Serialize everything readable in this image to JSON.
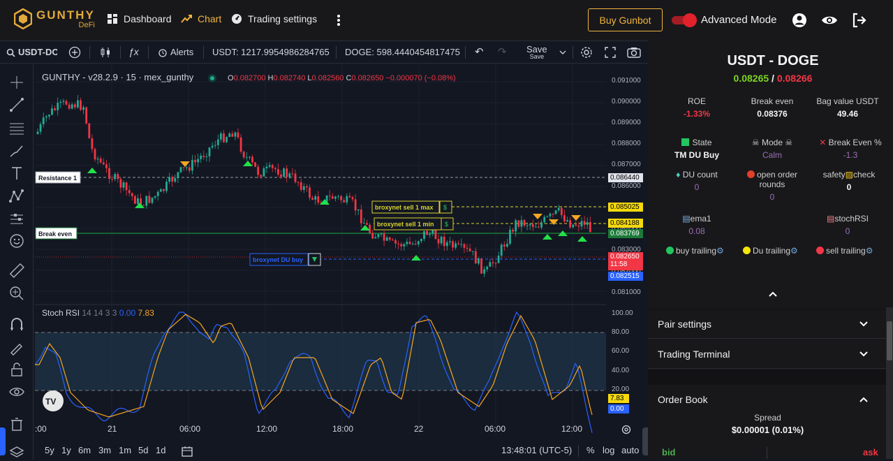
{
  "brand": {
    "name": "GUNTHY",
    "sub": "DeFi"
  },
  "nav": {
    "dashboard": "Dashboard",
    "chart": "Chart",
    "trading_settings": "Trading settings",
    "buy_button": "Buy Gunbot",
    "advanced_mode": "Advanced Mode"
  },
  "toolbar": {
    "symbol": "USDT-DOG",
    "alerts": "Alerts",
    "usdt_balance": "USDT: 1217.9954986284765",
    "doge_balance": "DOGE: 598.4440454817475",
    "save": "Save",
    "save_sub": "Save"
  },
  "legend": {
    "title": "GUNTHY - v28.2.9 · 15 · mex_gunthy",
    "o_label": "O",
    "o": "0.082700",
    "h_label": "H",
    "h": "0.082740",
    "l_label": "L",
    "l": "0.082560",
    "c_label": "C",
    "c": "0.082650",
    "change": "−0.000070 (−0.08%)"
  },
  "stoch_legend": {
    "name": "Stoch RSI",
    "params": "14 14 3 3",
    "k": "0.00",
    "d": "7.83"
  },
  "price_axis": [
    "0.091000",
    "0.090000",
    "0.089000",
    "0.088000",
    "0.087000",
    "0.086000",
    "0.085000",
    "0.084000",
    "0.083000",
    "0.082000",
    "0.081000"
  ],
  "stoch_axis": [
    "100.00",
    "80.00",
    "60.00",
    "40.00",
    "20.00"
  ],
  "price_tags": {
    "resistance": "0.086440",
    "sell_max": "0.085025",
    "sell_min": "0.084188",
    "break_even": "0.083769",
    "last": "0.082650",
    "countdown": "11:58",
    "du_buy": "0.082515",
    "stoch_d": "7.83",
    "stoch_k": "0.00"
  },
  "chart_labels": {
    "resistance": "Resistance 1",
    "break_even": "Break even",
    "sell_max": "broxynet sell 1 max",
    "sell_min": "broxynet sell 1 min",
    "du_buy": "broxynet DU buy",
    "dollar": "$"
  },
  "time_axis": [
    ":00",
    "21",
    "06:00",
    "12:00",
    "18:00",
    "22",
    "06:00",
    "12:00"
  ],
  "bottom_bar": {
    "ranges": [
      "5y",
      "1y",
      "6m",
      "3m",
      "1m",
      "5d",
      "1d"
    ],
    "clock": "13:48:01 (UTC-5)",
    "percent": "%",
    "log": "log",
    "auto": "auto"
  },
  "side": {
    "pair": "USDT - DOGE",
    "bid_price": "0.08265",
    "sep": " / ",
    "ask_price": "0.08266",
    "stats": {
      "roe_label": "ROE",
      "roe": "-1.33%",
      "be_label": "Break even",
      "be": "0.08376",
      "bag_label": "Bag value USDT",
      "bag": "49.46",
      "state_label": "State",
      "state": "TM DU Buy",
      "mode_label": "Mode",
      "mode": "Calm",
      "bep_label": "Break Even %",
      "bep": "-1.3",
      "du_label": "DU count",
      "du": "0",
      "oor_label": "open order rounds",
      "oor": "0",
      "safety_label_a": "safety",
      "safety_label_b": "check",
      "safety": "0",
      "ema_label": "ema1",
      "ema": "0.08",
      "srsi_label": "stochRSI",
      "srsi": "0",
      "buy_trailing": "buy trailing",
      "du_trailing": "Du trailing",
      "sell_trailing": "sell trailing"
    },
    "pair_settings": "Pair settings",
    "trading_terminal": "Trading Terminal",
    "order_book": "Order Book",
    "spread_label": "Spread",
    "spread": "$0.00001 (0.01%)",
    "bid": "bid",
    "ask": "ask"
  },
  "colors": {
    "accent": "#f0b43c",
    "up": "#22ab94",
    "down": "#f23645",
    "positive": "#4caf50"
  }
}
